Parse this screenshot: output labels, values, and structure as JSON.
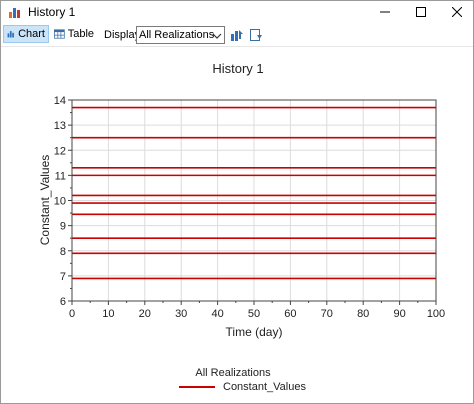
{
  "window": {
    "title": "History 1"
  },
  "toolbar": {
    "chart_label": "Chart",
    "table_label": "Table",
    "display_label": "Display:",
    "display_value": "All Realizations"
  },
  "chart_data": {
    "type": "line",
    "title": "History 1",
    "xlabel": "Time (day)",
    "ylabel": "Constant_Values",
    "xlim": [
      0,
      100
    ],
    "ylim": [
      6,
      14
    ],
    "xticks": [
      0,
      10,
      20,
      30,
      40,
      50,
      60,
      70,
      80,
      90,
      100
    ],
    "yticks": [
      6,
      7,
      8,
      9,
      10,
      11,
      12,
      13,
      14
    ],
    "grid": true,
    "legend_title": "All Realizations",
    "legend_position": "bottom",
    "series_name": "Constant_Values",
    "series_color": "#cc0000",
    "constant_values": [
      13.7,
      12.5,
      11.3,
      11.0,
      10.2,
      9.9,
      9.45,
      8.5,
      7.9,
      6.9
    ]
  },
  "colors": {
    "accent": "#cc0000",
    "active_tab": "#cce4f7"
  },
  "icons": {
    "app": "chart-app-icon",
    "chart": "bar-chart-icon",
    "table": "table-icon",
    "export": "export-icon",
    "copy": "copy-icon"
  }
}
